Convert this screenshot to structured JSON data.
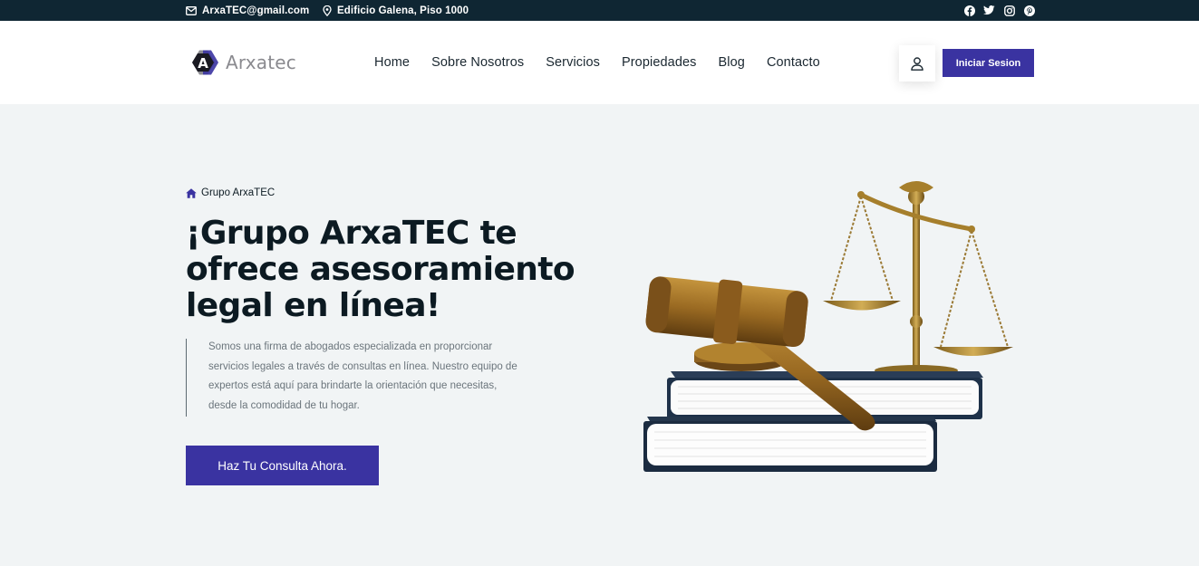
{
  "topbar": {
    "email": "ArxaTEC@gmail.com",
    "address": "Edificio Galena, Piso 1000",
    "icons": [
      "mail-icon",
      "location-pin-icon"
    ],
    "socials": [
      "facebook-icon",
      "twitter-icon",
      "instagram-icon",
      "pinterest-icon"
    ]
  },
  "header": {
    "logo_text": "Arxatec",
    "logo_letter": "A",
    "nav": [
      "Home",
      "Sobre Nosotros",
      "Servicios",
      "Propiedades",
      "Blog",
      "Contacto"
    ],
    "user_icon": "user-icon",
    "login_label": "Iniciar Sesion"
  },
  "hero": {
    "breadcrumb_icon": "home-icon",
    "breadcrumb": "Grupo ArxaTEC",
    "title": "¡Grupo ArxaTEC te ofrece asesoramiento legal en línea!",
    "description": "Somos una firma de abogados especializada en proporcionar servicios legales a través de consultas en línea. Nuestro equipo de expertos está aquí para brindarte la orientación que necesitas, desde la comodidad de tu hogar.",
    "cta_label": "Haz Tu Consulta Ahora.",
    "image": "gavel-scales-books-illustration"
  },
  "colors": {
    "topbar_bg": "#0f2633",
    "accent": "#3a33a1",
    "hero_bg": "#f1f4f5"
  }
}
